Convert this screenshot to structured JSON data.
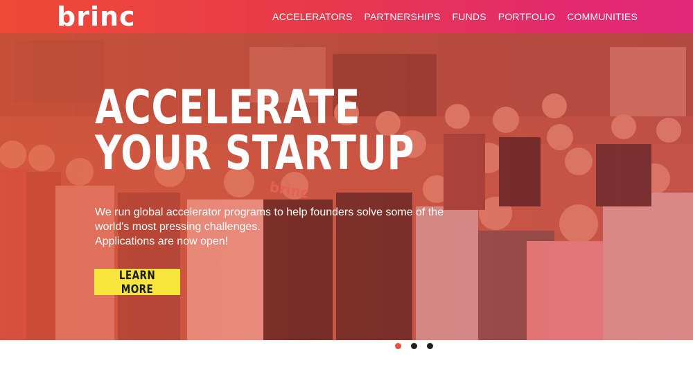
{
  "brand": {
    "logo_text": "brinc"
  },
  "nav": {
    "items": [
      {
        "label": "ACCELERATORS"
      },
      {
        "label": "PARTNERSHIPS"
      },
      {
        "label": "FUNDS"
      },
      {
        "label": "PORTFOLIO"
      },
      {
        "label": "COMMUNITIES"
      }
    ]
  },
  "hero": {
    "headline_line1": "ACCELERATE",
    "headline_line2": "YOUR STARTUP",
    "subtext_line1": "We run global accelerator programs to help founders solve some of the",
    "subtext_line2": "world's most pressing challenges.",
    "subtext_line3": "Applications are now open!",
    "cta_label": "LEARN MORE",
    "photo_shirt_text": "brinc"
  },
  "carousel": {
    "slide_count": 3,
    "active_index": 0
  },
  "colors": {
    "header_gradient_start": "#ef4a37",
    "header_gradient_end": "#e3287a",
    "cta_background": "#f7e53b",
    "dot_active": "#e8503a",
    "dot_inactive": "#1e1e1e"
  }
}
